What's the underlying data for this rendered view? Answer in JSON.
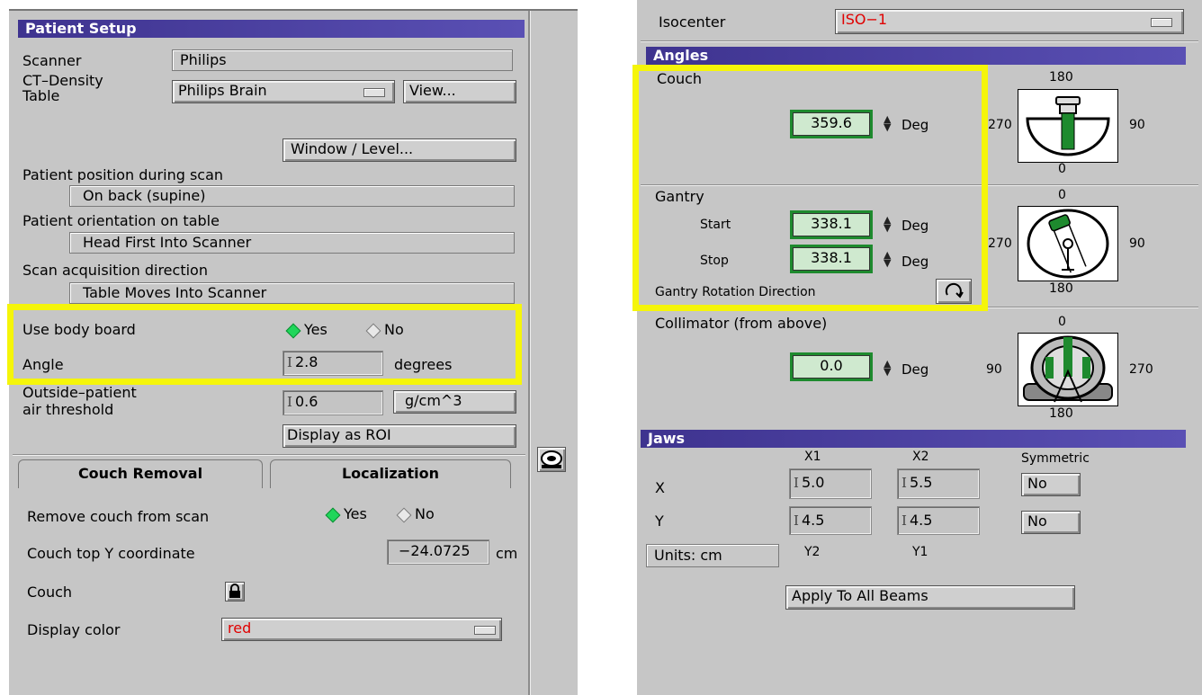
{
  "patient_setup": {
    "title": "Patient Setup",
    "scanner_label": "Scanner",
    "scanner_value": "Philips",
    "ct_density_label_1": "CT–Density",
    "ct_density_label_2": "Table",
    "ct_density_value": "Philips Brain",
    "view_button": "View...",
    "window_level_button": "Window / Level...",
    "position_label": "Patient position during scan",
    "position_value": "On back (supine)",
    "orientation_label": "Patient orientation on table",
    "orientation_value": "Head First Into Scanner",
    "direction_label": "Scan acquisition direction",
    "direction_value": "Table Moves Into Scanner",
    "body_board_label": "Use body board",
    "body_board_yes": "Yes",
    "body_board_no": "No",
    "body_board_selected": "Yes",
    "angle_label": "Angle",
    "angle_value": "2.8",
    "angle_unit": "degrees",
    "air_label_1": "Outside–patient",
    "air_label_2": "air threshold",
    "air_value": "0.6",
    "air_unit": "g/cm^3",
    "display_roi_button": "Display as ROI",
    "tabs": [
      "Couch Removal",
      "Localization"
    ],
    "active_tab": "Couch Removal",
    "remove_couch_label": "Remove couch from scan",
    "remove_couch_yes": "Yes",
    "remove_couch_no": "No",
    "couch_y_label": "Couch top Y coordinate",
    "couch_y_value": "−24.0725",
    "couch_y_unit": "cm",
    "couch_label": "Couch",
    "display_color_label": "Display color",
    "display_color_value": "red"
  },
  "beam": {
    "isocenter_label": "Isocenter",
    "isocenter_value": "ISO−1",
    "angles_title": "Angles",
    "couch_label": "Couch",
    "couch_value": "359.6",
    "deg": "Deg",
    "couch_dial": {
      "top": "180",
      "left": "270",
      "right": "90",
      "bottom": "0"
    },
    "gantry_label": "Gantry",
    "start_label": "Start",
    "start_value": "338.1",
    "stop_label": "Stop",
    "stop_value": "338.1",
    "rotation_label": "Gantry Rotation Direction",
    "gantry_dial": {
      "top": "0",
      "left": "270",
      "right": "90",
      "bottom": "180"
    },
    "collimator_label": "Collimator (from above)",
    "collimator_value": "0.0",
    "collimator_dial": {
      "top": "0",
      "left": "90",
      "right": "270",
      "bottom": "180"
    },
    "jaws_title": "Jaws",
    "x1_label": "X1",
    "x2_label": "X2",
    "symmetric_label": "Symmetric",
    "x_label": "X",
    "y_label": "Y",
    "x1_value": "5.0",
    "x2_value": "5.5",
    "y2_value": "4.5",
    "y1_value": "4.5",
    "x_symmetric": "No",
    "y_symmetric": "No",
    "units_label": "Units: cm",
    "y2_label": "Y2",
    "y1_label": "Y1",
    "apply_button": "Apply To All Beams"
  },
  "colors": {
    "panel_bg": "#c6c6c6",
    "header_bg": "#4a3fa2",
    "highlight": "#f5f50a",
    "field_green": "#1e8a2e",
    "selected_diamond": "#1fd65a",
    "red_text": "#e00000"
  }
}
